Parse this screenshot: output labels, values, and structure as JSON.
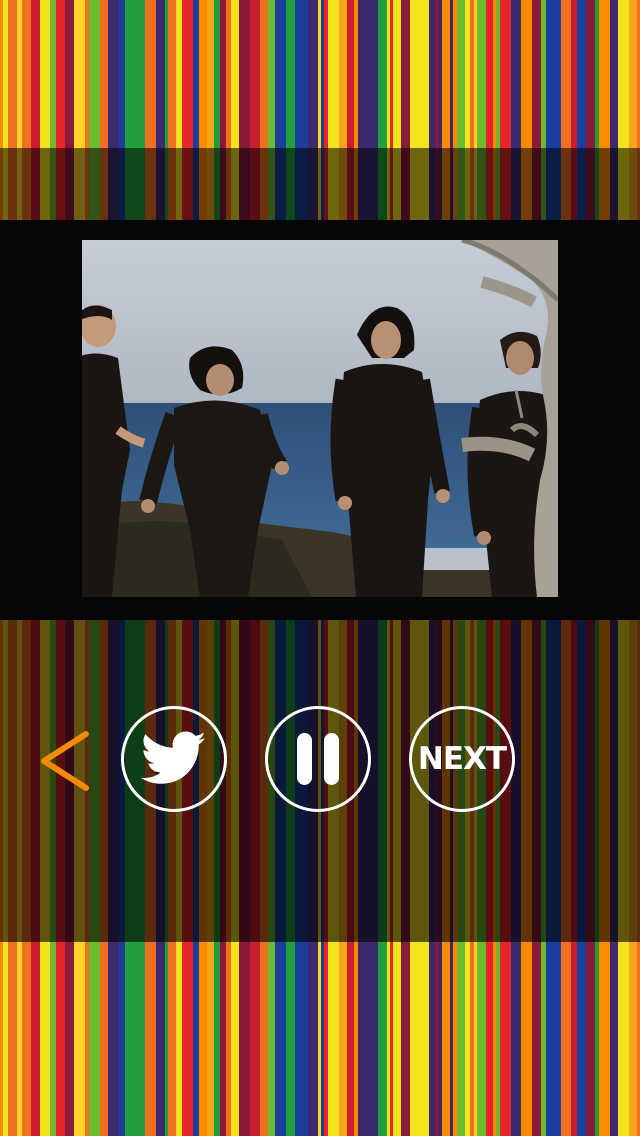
{
  "player": {
    "next_label": "NEXT"
  },
  "icons": {
    "back": "chevron-left-icon",
    "share": "twitter-bird-icon",
    "pause": "pause-icon"
  },
  "colors": {
    "back_arrow": "#f28a0c",
    "button_outline": "#ffffff",
    "stripe_palette": [
      "#e8252a",
      "#f5a61b",
      "#f3e21e",
      "#23a03d",
      "#1a3f9c",
      "#8a1a3a",
      "#f07020",
      "#c81e2d",
      "#6bbd2e",
      "#ffd32a",
      "#3b2a6e",
      "#ff8a00"
    ]
  }
}
